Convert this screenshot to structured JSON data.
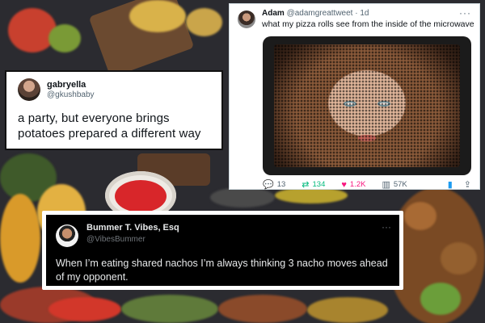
{
  "colors": {
    "accent_blue": "#1d9bf0",
    "retweet_green": "#00ba7c",
    "like_pink": "#f91880",
    "dark_card_bg": "#000000",
    "light_card_bg": "#ffffff"
  },
  "tweets": [
    {
      "name": "gabryella",
      "handle": "@gkushbaby",
      "text": "a party, but everyone brings potatoes prepared a different way",
      "theme": "light"
    },
    {
      "name": "Adam",
      "handle": "@adamgreattweet",
      "time": "· 1d",
      "text": "what my pizza rolls see from the inside of the microwave",
      "theme": "light",
      "more_icon": "more-dots-icon",
      "media": "photo-behind-microwave-door-mesh",
      "metrics": {
        "replies": "13",
        "retweets": "134",
        "likes": "1.2K",
        "views": "57K"
      },
      "icons": {
        "reply": "💬",
        "retweet": "⇄",
        "like": "♥",
        "views": "▥",
        "bookmark": "▮",
        "share": "⇪"
      }
    },
    {
      "name": "Bummer T. Vibes, Esq",
      "handle": "@VibesBummer",
      "text": "When I’m eating shared nachos I’m always thinking 3 nacho moves ahead of my opponent.",
      "theme": "dark",
      "more_icon": "more-dots-icon"
    }
  ]
}
